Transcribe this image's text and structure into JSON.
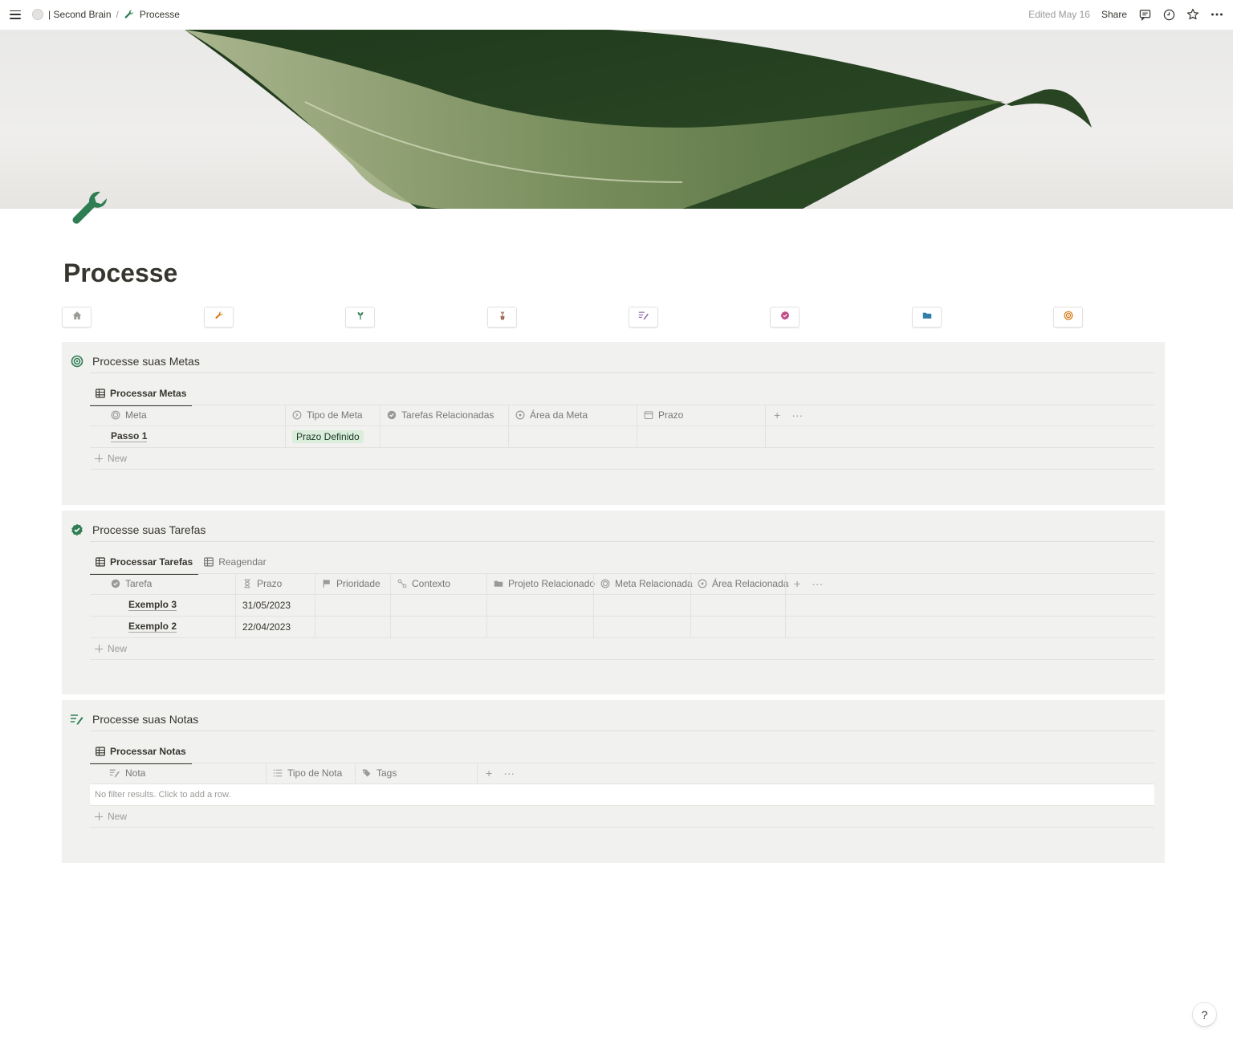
{
  "topbar": {
    "breadcrumb_workspace": "| Second Brain",
    "breadcrumb_sep": "/",
    "breadcrumb_page": "Processe",
    "edited": "Edited May 16",
    "share": "Share"
  },
  "page": {
    "title": "Processe",
    "icon": "wrench-icon"
  },
  "nav_icons": [
    "home-icon",
    "wrench-icon",
    "plant-icon",
    "potted-plant-icon",
    "notes-icon",
    "check-badge-icon",
    "folder-icon",
    "target-icon"
  ],
  "colors": {
    "accent_green": "#2f7d53",
    "orange": "#d9730d",
    "purple": "#9065b0",
    "pink": "#c14c8a",
    "blue": "#337ea9",
    "section_bg": "#f1f1ef",
    "tag_green_bg": "#dbeddb"
  },
  "metas": {
    "title": "Processe suas Metas",
    "icon": "target-icon",
    "tabs": [
      {
        "label": "Processar Metas"
      }
    ],
    "columns": [
      {
        "label": "Meta",
        "icon": "target-icon"
      },
      {
        "label": "Tipo de Meta",
        "icon": "circle-arrow-icon"
      },
      {
        "label": "Tarefas Relacionadas",
        "icon": "check-badge-icon"
      },
      {
        "label": "Área da Meta",
        "icon": "circle-target-icon"
      },
      {
        "label": "Prazo",
        "icon": "calendar-icon"
      }
    ],
    "rows": [
      {
        "name": "Passo 1",
        "tipo": "Prazo Definido"
      }
    ],
    "new_label": "New"
  },
  "tarefas": {
    "title": "Processe suas Tarefas",
    "icon": "check-badge-icon",
    "tabs": [
      {
        "label": "Processar Tarefas"
      },
      {
        "label": "Reagendar"
      }
    ],
    "columns": [
      {
        "label": "Tarefa",
        "icon": "check-badge-icon"
      },
      {
        "label": "Prazo",
        "icon": "hourglass-icon"
      },
      {
        "label": "Prioridade",
        "icon": "flag-icon"
      },
      {
        "label": "Contexto",
        "icon": "nodes-icon"
      },
      {
        "label": "Projeto Relacionado",
        "icon": "folder-icon"
      },
      {
        "label": "Meta Relacionada",
        "icon": "target-icon"
      },
      {
        "label": "Área Relacionada",
        "icon": "circle-target-icon"
      }
    ],
    "rows": [
      {
        "name": "Exemplo 3",
        "prazo": "31/05/2023"
      },
      {
        "name": "Exemplo 2",
        "prazo": "22/04/2023"
      }
    ],
    "new_label": "New"
  },
  "notas": {
    "title": "Processe suas Notas",
    "icon": "notes-icon",
    "tabs": [
      {
        "label": "Processar Notas"
      }
    ],
    "columns": [
      {
        "label": "Nota",
        "icon": "notes-icon"
      },
      {
        "label": "Tipo de Nota",
        "icon": "list-icon"
      },
      {
        "label": "Tags",
        "icon": "tags-icon"
      }
    ],
    "empty_text": "No filter results. Click to add a row.",
    "new_label": "New"
  },
  "help_label": "?"
}
